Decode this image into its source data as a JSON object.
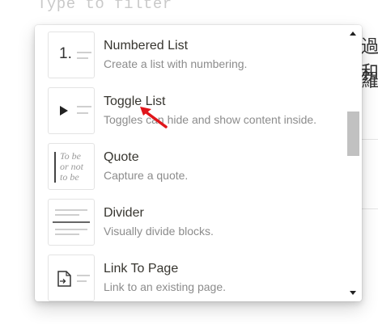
{
  "filter": {
    "placeholder": "Type to filter"
  },
  "background": {
    "cjk_line1": "過和",
    "cjk_line2": "羅"
  },
  "menu": {
    "items": [
      {
        "title": "Numbered List",
        "description": "Create a list with numbering.",
        "icon": "numbered-list-icon",
        "thumb_text": "1."
      },
      {
        "title": "Toggle List",
        "description": "Toggles can hide and show content inside.",
        "icon": "toggle-list-icon"
      },
      {
        "title": "Quote",
        "description": "Capture a quote.",
        "icon": "quote-icon",
        "thumb_text": "To be\nor not\nto be"
      },
      {
        "title": "Divider",
        "description": "Visually divide blocks.",
        "icon": "divider-icon"
      },
      {
        "title": "Link To Page",
        "description": "Link to an existing page.",
        "icon": "link-page-icon"
      }
    ]
  },
  "colors": {
    "cursor": "#e0161b",
    "accent_text": "#37352f",
    "muted_text": "#8c8c8c"
  }
}
